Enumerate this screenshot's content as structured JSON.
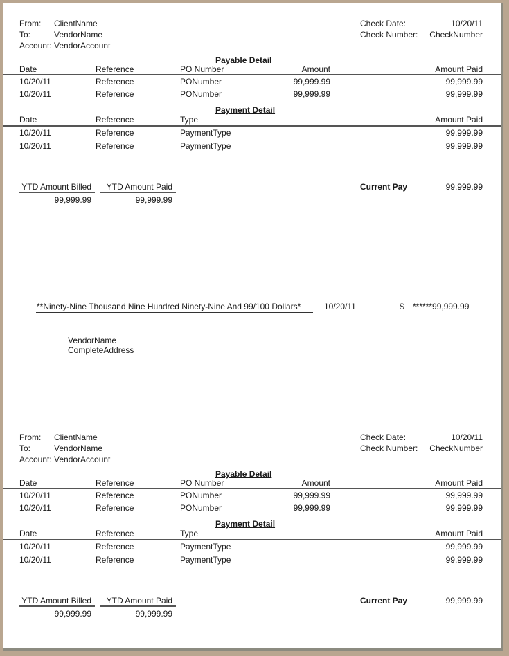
{
  "stubs": [
    {
      "header": {
        "from_label": "From:",
        "from_value": "ClientName",
        "to_label": "To:",
        "to_value": "VendorName",
        "account_label": "Account:",
        "account_value": "VendorAccount",
        "check_date_label": "Check Date:",
        "check_date_value": "10/20/11",
        "check_number_label": "Check Number:",
        "check_number_value": "CheckNumber"
      },
      "payable": {
        "title": "Payable Detail",
        "columns": [
          "Date",
          "Reference",
          "PO Number",
          "Amount",
          "Amount Paid"
        ],
        "rows": [
          [
            "10/20/11",
            "Reference",
            "PONumber",
            "99,999.99",
            "99,999.99"
          ],
          [
            "10/20/11",
            "Reference",
            "PONumber",
            "99,999.99",
            "99,999.99"
          ]
        ]
      },
      "payment": {
        "title": "Payment Detail",
        "columns": [
          "Date",
          "Reference",
          "Type",
          "Amount Paid"
        ],
        "rows": [
          [
            "10/20/11",
            "Reference",
            "PaymentType",
            "99,999.99"
          ],
          [
            "10/20/11",
            "Reference",
            "PaymentType",
            "99,999.99"
          ]
        ]
      },
      "summary": {
        "ytd_billed_label": "YTD Amount Billed",
        "ytd_billed_value": "99,999.99",
        "ytd_paid_label": "YTD Amount Paid",
        "ytd_paid_value": "99,999.99",
        "current_pay_label": "Current Pay",
        "current_pay_value": "99,999.99"
      }
    },
    {
      "header": {
        "from_label": "From:",
        "from_value": "ClientName",
        "to_label": "To:",
        "to_value": "VendorName",
        "account_label": "Account:",
        "account_value": "VendorAccount",
        "check_date_label": "Check Date:",
        "check_date_value": "10/20/11",
        "check_number_label": "Check Number:",
        "check_number_value": "CheckNumber"
      },
      "payable": {
        "title": "Payable Detail",
        "columns": [
          "Date",
          "Reference",
          "PO Number",
          "Amount",
          "Amount Paid"
        ],
        "rows": [
          [
            "10/20/11",
            "Reference",
            "PONumber",
            "99,999.99",
            "99,999.99"
          ],
          [
            "10/20/11",
            "Reference",
            "PONumber",
            "99,999.99",
            "99,999.99"
          ]
        ]
      },
      "payment": {
        "title": "Payment Detail",
        "columns": [
          "Date",
          "Reference",
          "Type",
          "Amount Paid"
        ],
        "rows": [
          [
            "10/20/11",
            "Reference",
            "PaymentType",
            "99,999.99"
          ],
          [
            "10/20/11",
            "Reference",
            "PaymentType",
            "99,999.99"
          ]
        ]
      },
      "summary": {
        "ytd_billed_label": "YTD Amount Billed",
        "ytd_billed_value": "99,999.99",
        "ytd_paid_label": "YTD Amount Paid",
        "ytd_paid_value": "99,999.99",
        "current_pay_label": "Current Pay",
        "current_pay_value": "99,999.99"
      }
    }
  ],
  "check": {
    "amount_words": "**Ninety-Nine Thousand Nine Hundred Ninety-Nine And 99/100 Dollars*",
    "date": "10/20/11",
    "currency_symbol": "$",
    "amount": "******99,999.99",
    "payee_name": "VendorName",
    "payee_address": "CompleteAddress"
  }
}
